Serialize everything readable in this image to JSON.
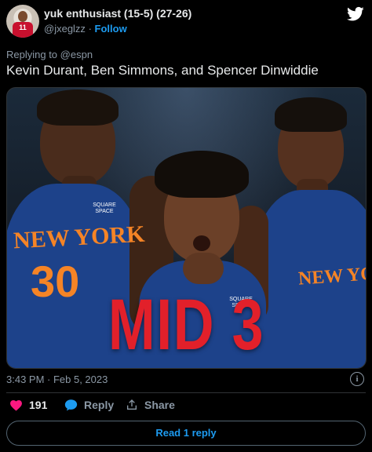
{
  "author": {
    "display_name": "yuk enthusiast (15-5) (27-26)",
    "handle": "@jxeglzz",
    "separator": "·",
    "follow_label": "Follow",
    "avatar_jersey_number": "11"
  },
  "reply_context": {
    "prefix": "Replying to",
    "target": "@espn"
  },
  "tweet_text": "Kevin Durant, Ben Simmons, and Spencer Dinwiddie",
  "media": {
    "overlay_text": "MID 3",
    "jersey_team_left": "NEW YORK",
    "jersey_number_left": "30",
    "jersey_team_right": "NEW YORK",
    "sponsor_line1": "SQUARE",
    "sponsor_line2": "SPACE"
  },
  "meta": {
    "timestamp": "3:43 PM · Feb 5, 2023"
  },
  "actions": {
    "like_count": "191",
    "reply_label": "Reply",
    "share_label": "Share"
  },
  "read_replies_label": "Read 1 reply",
  "colors": {
    "accent": "#1d9bf0",
    "like": "#f91880",
    "overlay_red": "#e2202a",
    "knicks_orange": "#f58426",
    "knicks_blue": "#1d428a"
  },
  "icons": [
    "twitter-bird-icon",
    "info-icon",
    "heart-icon",
    "reply-bubble-icon",
    "share-icon"
  ]
}
